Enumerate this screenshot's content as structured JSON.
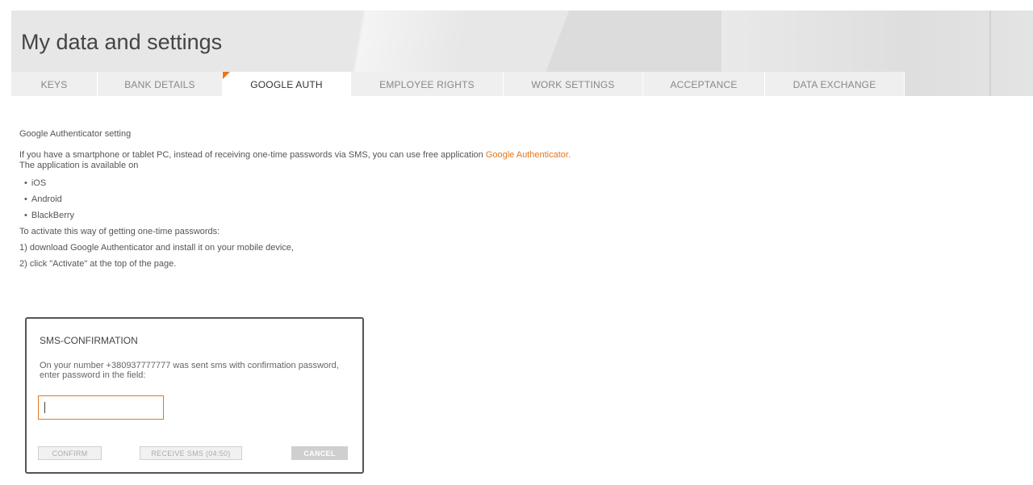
{
  "page": {
    "title": "My data and settings"
  },
  "tabs": [
    {
      "label": "KEYS",
      "active": false
    },
    {
      "label": "BANK DETAILS",
      "active": false
    },
    {
      "label": "GOOGLE AUTH",
      "active": true
    },
    {
      "label": "EMPLOYEE RIGHTS",
      "active": false
    },
    {
      "label": "WORK SETTINGS",
      "active": false
    },
    {
      "label": "ACCEPTANCE",
      "active": false
    },
    {
      "label": "DATA EXCHANGE",
      "active": false
    }
  ],
  "content": {
    "section_title": "Google Authenticator setting",
    "intro_text": "If you have a smartphone or tablet PC, instead of receiving one-time passwords via SMS, you can use free application ",
    "intro_link": "Google Authenticator.",
    "availability": "The application is available on",
    "platforms": [
      "iOS",
      "Android",
      "BlackBerry"
    ],
    "activate_intro": "To activate this way of getting one-time passwords:",
    "step1": "1) download Google Authenticator and install it on your mobile device,",
    "step2": "2) click \"Activate\" at the top of the page."
  },
  "modal": {
    "title": "SMS-CONFIRMATION",
    "message": "On your number +380937777777 was sent sms with confirmation password, enter password in the field:",
    "input_value": "",
    "confirm_label": "CONFIRM",
    "receive_label": "RECEIVE SMS (04:50)",
    "cancel_label": "CANCEL"
  },
  "colors": {
    "accent": "#e4771f",
    "header_bg": "#e7e7e7",
    "tab_bg": "#efefef"
  }
}
